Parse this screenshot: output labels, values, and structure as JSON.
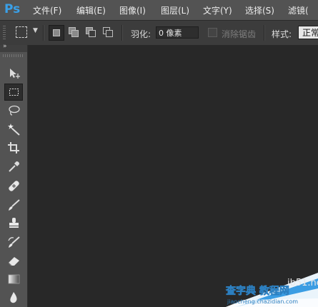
{
  "app": {
    "logo": "Ps"
  },
  "menubar": {
    "items": [
      "文件(F)",
      "编辑(E)",
      "图像(I)",
      "图层(L)",
      "文字(Y)",
      "选择(S)",
      "滤镜("
    ]
  },
  "options": {
    "feather_label": "羽化:",
    "feather_value": "0 像素",
    "antialias_label": "消除锯齿",
    "style_label": "样式:",
    "style_value": "正常"
  },
  "toolbox": {
    "collapse": "»",
    "tools": [
      {
        "name": "move-tool",
        "icon": "move-icon"
      },
      {
        "name": "marquee-tool",
        "icon": "rect-marquee-icon",
        "active": true
      },
      {
        "name": "lasso-tool",
        "icon": "lasso-icon"
      },
      {
        "name": "magic-wand-tool",
        "icon": "magic-wand-icon"
      },
      {
        "name": "crop-tool",
        "icon": "crop-icon"
      },
      {
        "name": "eyedropper-tool",
        "icon": "eyedropper-icon"
      },
      {
        "name": "healing-brush-tool",
        "icon": "bandage-icon"
      },
      {
        "name": "brush-tool",
        "icon": "brush-icon"
      },
      {
        "name": "clone-stamp-tool",
        "icon": "stamp-icon"
      },
      {
        "name": "history-brush-tool",
        "icon": "history-brush-icon"
      },
      {
        "name": "eraser-tool",
        "icon": "eraser-icon"
      },
      {
        "name": "gradient-tool",
        "icon": "gradient-icon"
      },
      {
        "name": "blur-tool",
        "icon": "drop-icon"
      }
    ]
  },
  "watermark": {
    "line1": "jb51.net",
    "line2": "查字典 教程网",
    "line3": "jiaocheng.chazidian.com"
  },
  "colors": {
    "logo": "#3aa0e8",
    "menubar": "#535353",
    "options": "#3c3c3c",
    "canvas": "#282828"
  }
}
